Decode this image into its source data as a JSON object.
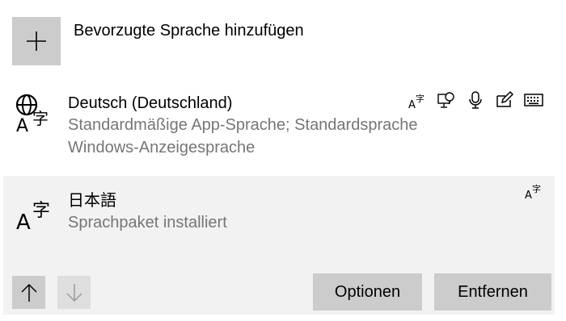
{
  "add_language": {
    "label": "Bevorzugte Sprache hinzufügen",
    "icon": "plus-icon"
  },
  "languages": [
    {
      "name": "Deutsch (Deutschland)",
      "status_lines": [
        "Standardmäßige App-Sprache; Standardsprache",
        "Windows-Anzeigesprache"
      ],
      "icon": "language-display-icon",
      "features": [
        "language-pack-icon",
        "text-to-speech-icon",
        "speech-recognition-icon",
        "handwriting-icon",
        "keyboard-icon"
      ],
      "selected": false
    },
    {
      "name": "日本語",
      "status_lines": [
        "Sprachpaket installiert"
      ],
      "icon": "language-icon",
      "features": [
        "language-pack-icon"
      ],
      "selected": true
    }
  ],
  "actions": {
    "move_up_icon": "arrow-up-icon",
    "move_down_icon": "arrow-down-icon",
    "options_label": "Optionen",
    "remove_label": "Entfernen"
  },
  "colors": {
    "tile_bg": "#cccccc",
    "selected_row_bg": "#f2f2f2",
    "secondary_text": "#767676"
  }
}
